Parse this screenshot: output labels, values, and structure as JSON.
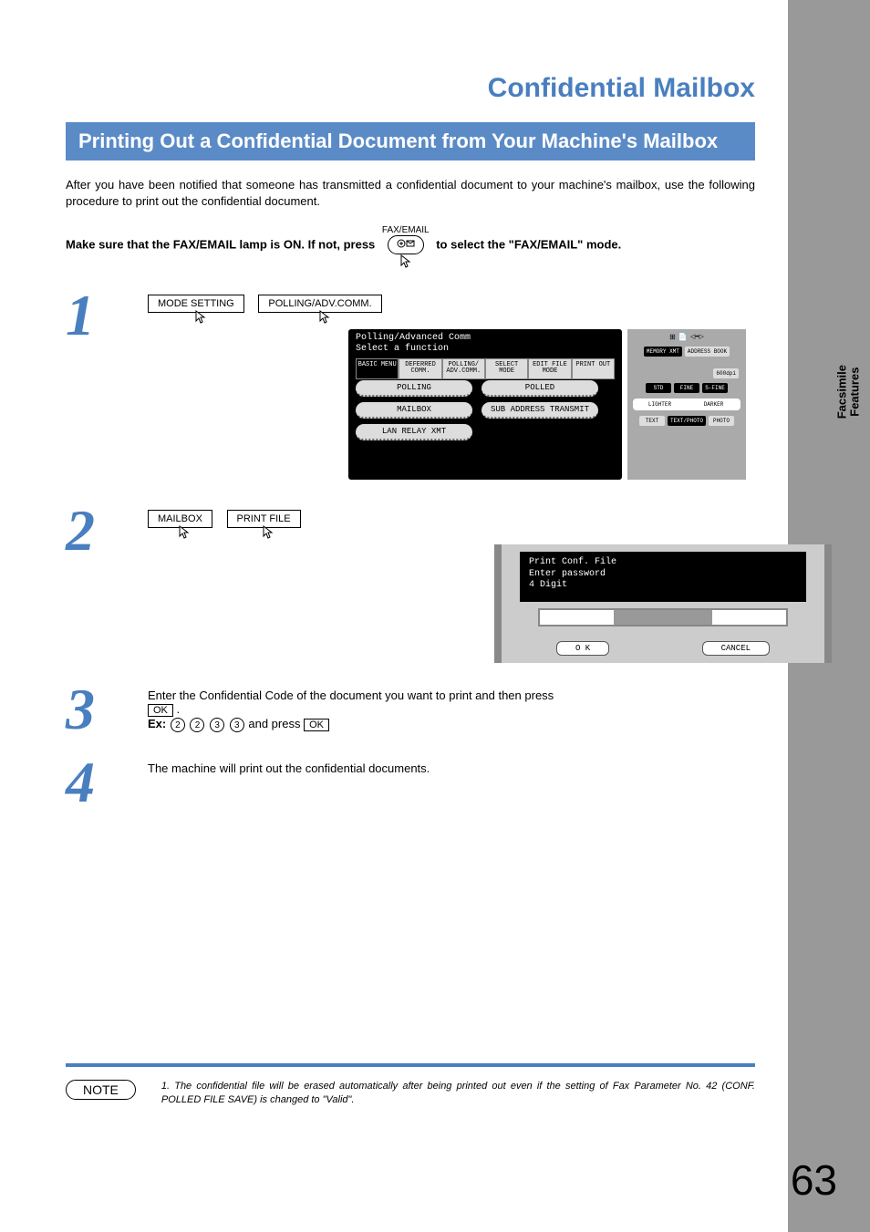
{
  "page_number": "63",
  "side_tab": "Facsimile\nFeatures",
  "section_title": "Confidential Mailbox",
  "bar_title": "Printing Out a Confidential Document from Your Machine's Mailbox",
  "intro": "After you have been notified that someone has transmitted a confidential document to your machine's mailbox, use the following procedure to print out the confidential document.",
  "modeline": {
    "pre": "Make sure that the FAX/EMAIL lamp is ON.  If not, press",
    "fax_label": "FAX/EMAIL",
    "post": "to select the \"FAX/EMAIL\" mode."
  },
  "steps": {
    "s1": {
      "num": "1",
      "btn1": "MODE SETTING",
      "btn2": "POLLING/ADV.COMM."
    },
    "s2": {
      "num": "2",
      "btn1": "MAILBOX",
      "btn2": "PRINT FILE"
    },
    "s3": {
      "num": "3",
      "text_a": "Enter the Confidential Code of the document you want to print and then press",
      "ok": "OK",
      "ex_label": "Ex:",
      "d1": "2",
      "d2": "2",
      "d3": "3",
      "d4": "3",
      "andpress": " and press "
    },
    "s4": {
      "num": "4",
      "text": "The machine will print out the confidential documents."
    }
  },
  "panel1": {
    "title1": "Polling/Advanced Comm",
    "title2": "Select a function",
    "tabs": [
      "BASIC MENU",
      "DEFERRED COMM.",
      "POLLING/ ADV.COMM.",
      "SELECT MODE",
      "EDIT FILE MODE",
      "PRINT OUT"
    ],
    "buttons": [
      "POLLING",
      "POLLED",
      "MAILBOX",
      "SUB ADDRESS TRANSMIT",
      "LAN RELAY XMT"
    ],
    "right_top": [
      "MEMORY XMT",
      "ADDRESS BOOK"
    ],
    "res": "600dpi",
    "modes": [
      "STD",
      "FINE",
      "S-FINE"
    ],
    "density": [
      "LIGHTER",
      "DARKER"
    ],
    "orig": [
      "TEXT",
      "TEXT/PHOTO",
      "PHOTO"
    ]
  },
  "panel2": {
    "l1": "Print Conf. File",
    "l2": "Enter password",
    "l3": "4 Digit",
    "ok": "O K",
    "cancel": "CANCEL"
  },
  "note": {
    "label": "NOTE",
    "text": "1.  The confidential file will be erased automatically after being printed out even if the setting of Fax Parameter No. 42 (CONF. POLLED FILE SAVE) is changed to \"Valid\"."
  }
}
